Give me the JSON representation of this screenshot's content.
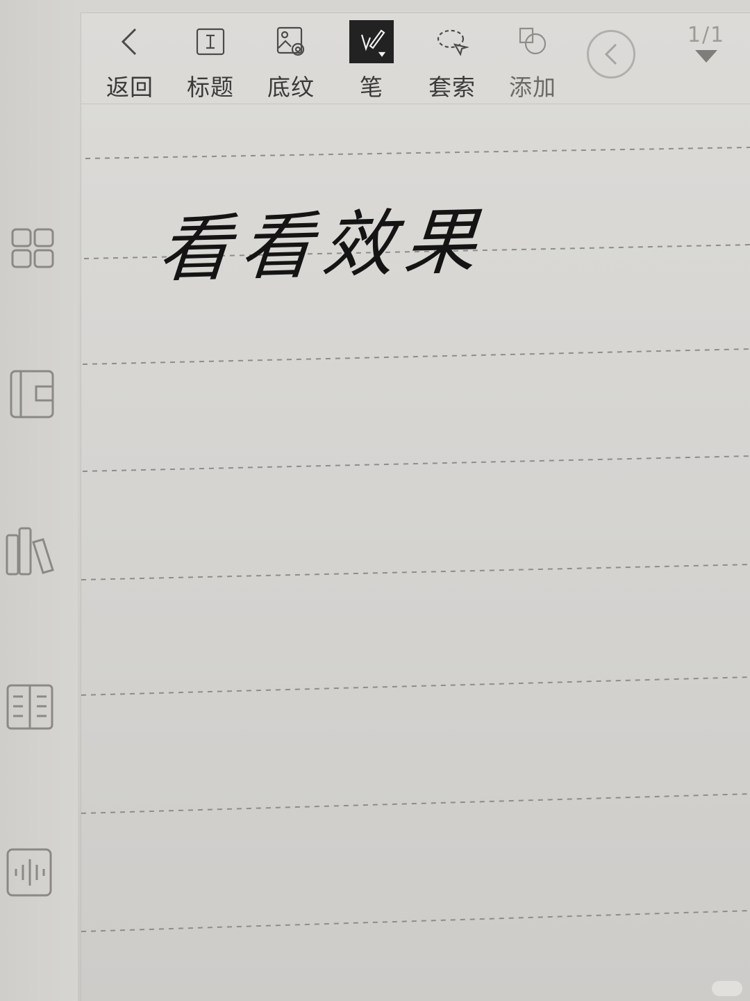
{
  "toolbar": {
    "back_label": "返回",
    "title_label": "标题",
    "background_label": "底纹",
    "pen_label": "笔",
    "lasso_label": "套索",
    "add_label": "添加"
  },
  "pagination": {
    "current": "1/1"
  },
  "note": {
    "handwritten_text": "看看效果"
  },
  "colors": {
    "ink": "#141414",
    "active_tool_bg": "#222222",
    "screen": "#d7d6d3"
  },
  "sidebar": {
    "icons": [
      "grid-icon",
      "notebook-icon",
      "bookshelf-icon",
      "book-open-icon",
      "audio-wave-icon"
    ]
  }
}
